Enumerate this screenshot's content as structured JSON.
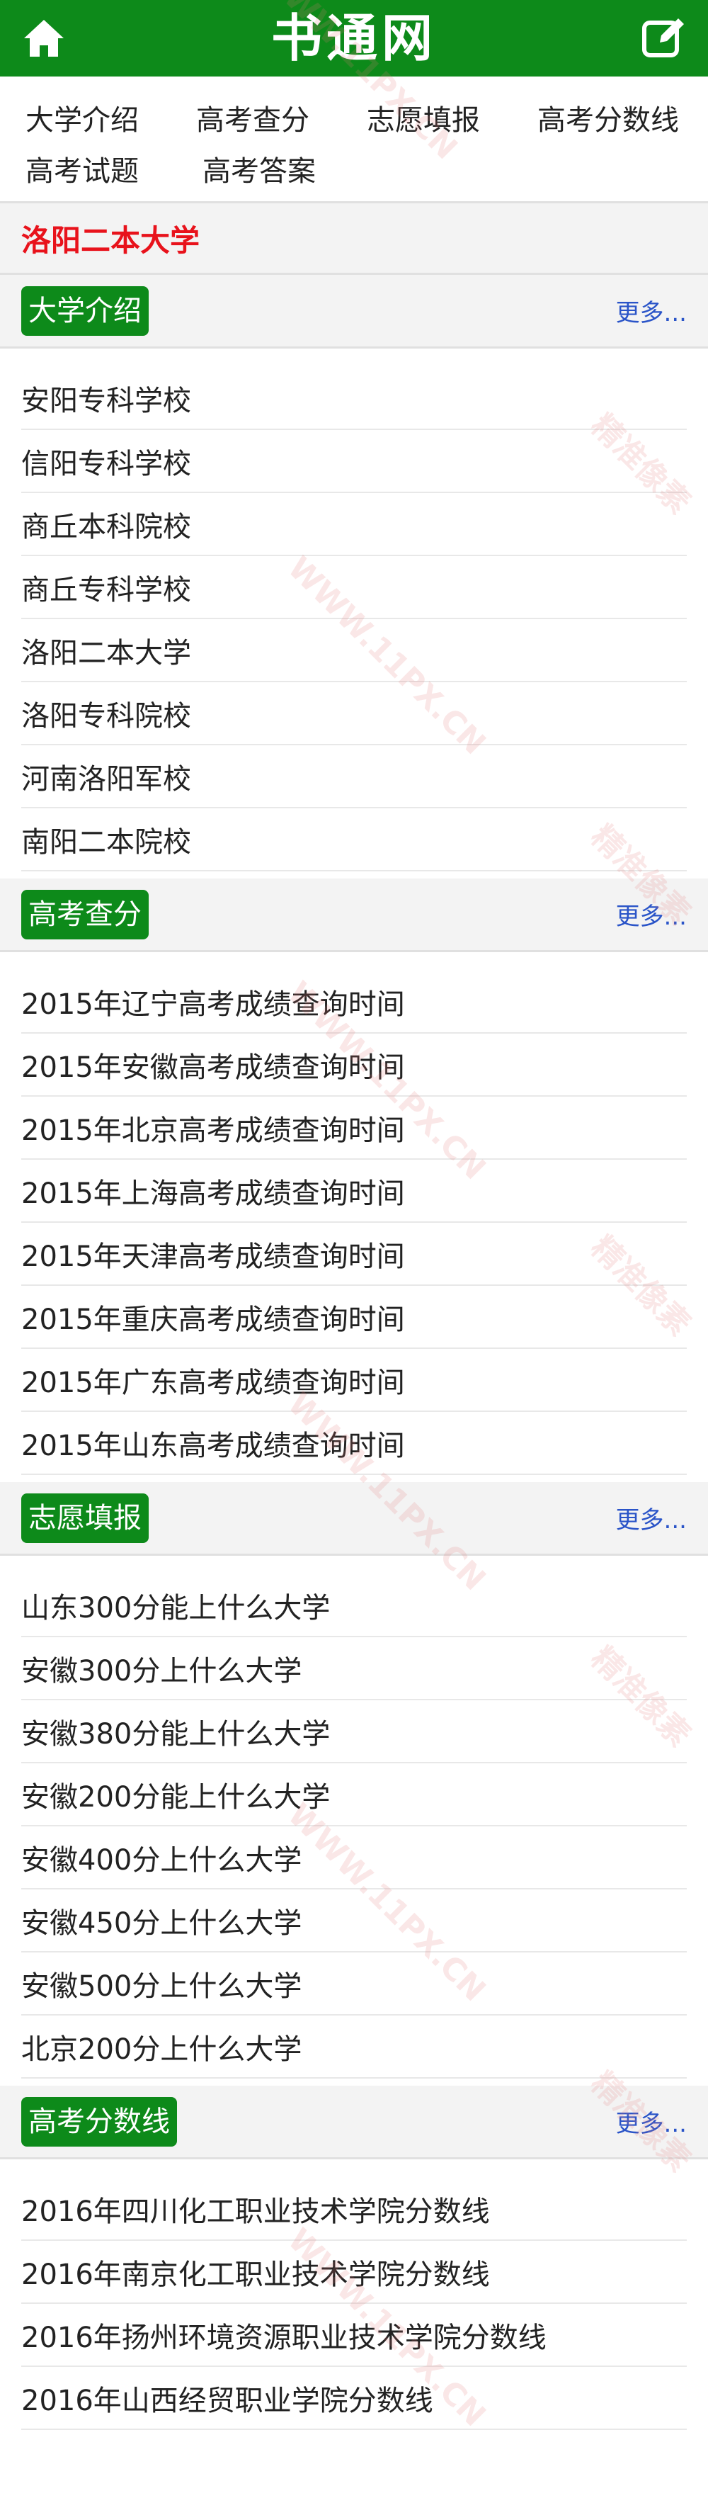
{
  "header": {
    "title": "书通网",
    "home_icon": "home-icon",
    "edit_icon": "edit-icon",
    "bg_color": "#0d8a1a"
  },
  "nav": {
    "row1": [
      "大学介绍",
      "高考查分",
      "志愿填报",
      "高考分数线"
    ],
    "row2": [
      "高考试题",
      "高考答案"
    ]
  },
  "current_school": {
    "label": "洛阳二本大学",
    "color": "#e8121b"
  },
  "sections": [
    {
      "title": "大学介绍",
      "more": "更多...",
      "items": [
        "安阳专科学校",
        "信阳专科学校",
        "商丘本科院校",
        "商丘专科学校",
        "洛阳二本大学",
        "洛阳专科院校",
        "河南洛阳军校",
        "南阳二本院校"
      ]
    },
    {
      "title": "高考查分",
      "more": "更多...",
      "items": [
        "2015年辽宁高考成绩查询时间",
        "2015年安徽高考成绩查询时间",
        "2015年北京高考成绩查询时间",
        "2015年上海高考成绩查询时间",
        "2015年天津高考成绩查询时间",
        "2015年重庆高考成绩查询时间",
        "2015年广东高考成绩查询时间",
        "2015年山东高考成绩查询时间"
      ]
    },
    {
      "title": "志愿填报",
      "more": "更多...",
      "items": [
        "山东300分能上什么大学",
        "安徽300分上什么大学",
        "安徽380分能上什么大学",
        "安徽200分能上什么大学",
        "安徽400分上什么大学",
        "安徽450分上什么大学",
        "安徽500分上什么大学",
        "北京200分上什么大学"
      ]
    },
    {
      "title": "高考分数线",
      "more": "更多...",
      "items": [
        "2016年四川化工职业技术学院分数线",
        "2016年南京化工职业技术学院分数线",
        "2016年扬州环境资源职业技术学院分数线",
        "2016年山西经贸职业学院分数线"
      ]
    }
  ],
  "watermark": {
    "text_a": "精准像素",
    "text_b": "WWW.11PX.CN"
  }
}
